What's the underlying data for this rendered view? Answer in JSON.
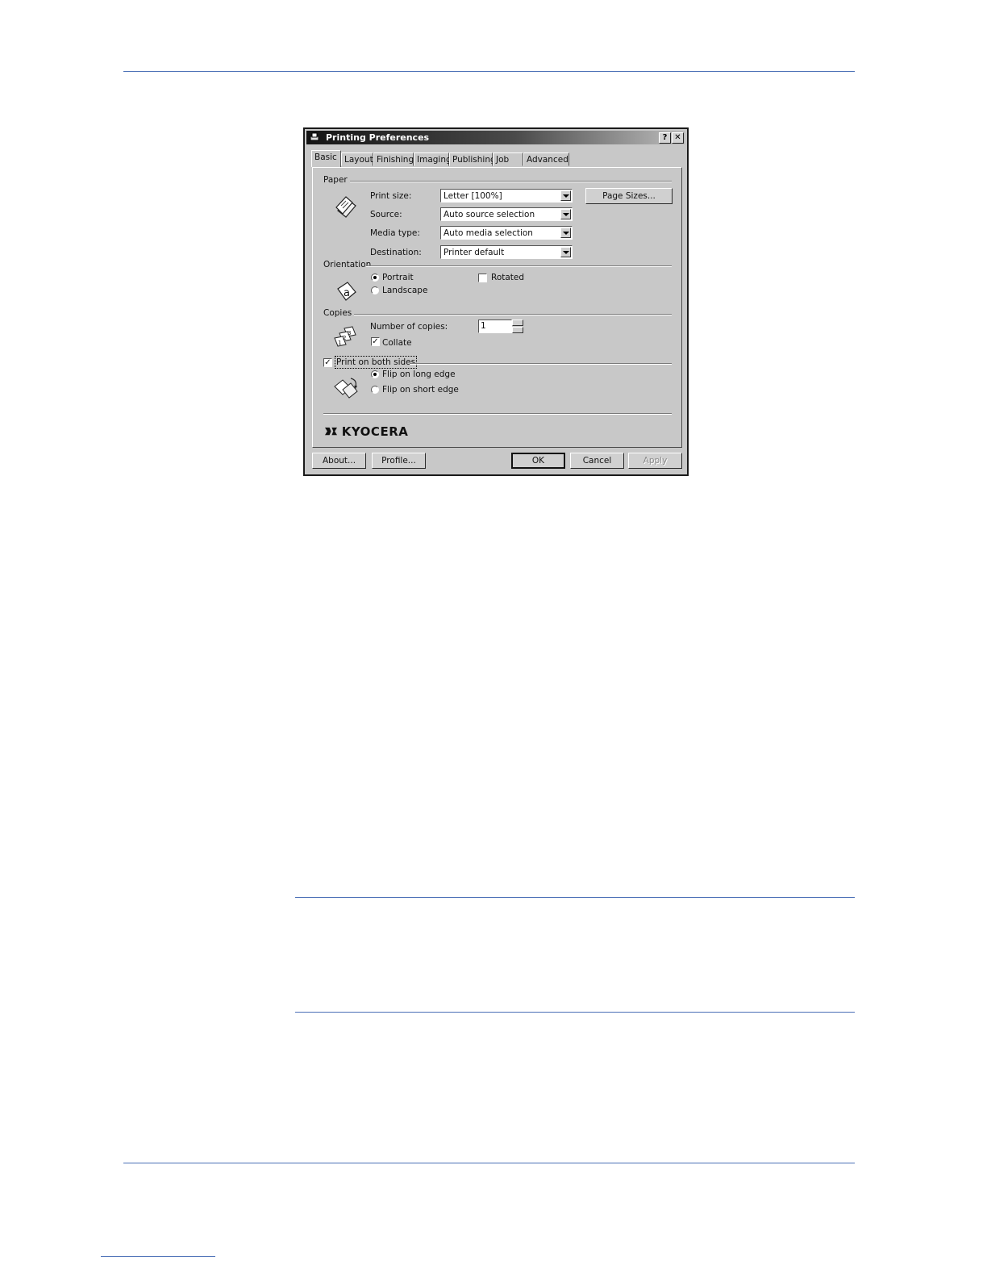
{
  "dialog": {
    "title": "Printing Preferences",
    "help_button": "?",
    "close_button": "✕",
    "tabs": [
      "Basic",
      "Layout",
      "Finishing",
      "Imaging",
      "Publishing",
      "Job",
      "Advanced"
    ],
    "active_tab": "Basic"
  },
  "paper": {
    "group_label": "Paper",
    "print_size_label": "Print size:",
    "print_size_value": "Letter [100%]",
    "source_label": "Source:",
    "source_value": "Auto source selection",
    "media_type_label": "Media type:",
    "media_type_value": "Auto media selection",
    "destination_label": "Destination:",
    "destination_value": "Printer default",
    "page_sizes_button": "Page Sizes..."
  },
  "orientation": {
    "group_label": "Orientation",
    "portrait_label": "Portrait",
    "landscape_label": "Landscape",
    "rotated_label": "Rotated",
    "selected": "Portrait",
    "rotated_checked": false
  },
  "copies": {
    "group_label": "Copies",
    "number_label": "Number of copies:",
    "number_value": "1",
    "collate_label": "Collate",
    "collate_checked": true
  },
  "duplex": {
    "group_label": "Print on both sides",
    "enabled": true,
    "long_edge_label": "Flip on long edge",
    "short_edge_label": "Flip on short edge",
    "selected": "Flip on long edge"
  },
  "brand": {
    "logo_text": "KYOCERA"
  },
  "footer": {
    "about_button": "About...",
    "profile_button": "Profile...",
    "ok_button": "OK",
    "cancel_button": "Cancel",
    "apply_button": "Apply"
  },
  "colors": {
    "rule": "#4a6fb6",
    "dialog_face": "#c8c8c8"
  }
}
